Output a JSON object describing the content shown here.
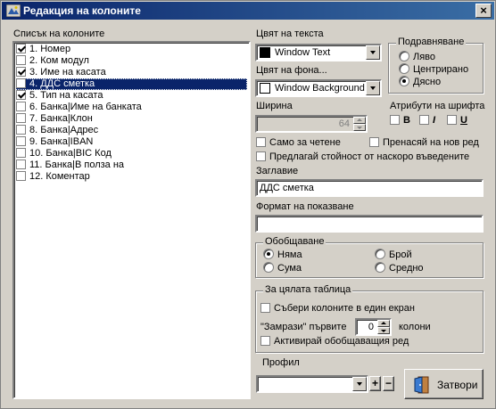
{
  "window": {
    "title": "Редакция на колоните",
    "close_glyph": "×"
  },
  "columns": {
    "label": "Списък на колоните",
    "items": [
      {
        "label": "1. Номер",
        "checked": true,
        "selected": false
      },
      {
        "label": "2. Ком модул",
        "checked": false,
        "selected": false
      },
      {
        "label": "3. Име на касата",
        "checked": true,
        "selected": false
      },
      {
        "label": "4. ДДС сметка",
        "checked": false,
        "selected": true
      },
      {
        "label": "5. Тип на касата",
        "checked": true,
        "selected": false
      },
      {
        "label": "6. Банка|Име на банката",
        "checked": false,
        "selected": false
      },
      {
        "label": "7. Банка|Клон",
        "checked": false,
        "selected": false
      },
      {
        "label": "8. Банка|Адрес",
        "checked": false,
        "selected": false
      },
      {
        "label": "9. Банка|IBAN",
        "checked": false,
        "selected": false
      },
      {
        "label": "10. Банка|BIC Код",
        "checked": false,
        "selected": false
      },
      {
        "label": "11. Банка|В полза на",
        "checked": false,
        "selected": false
      },
      {
        "label": "12. Коментар",
        "checked": false,
        "selected": false
      }
    ]
  },
  "text_color": {
    "label": "Цвят на текста",
    "value": "Window Text",
    "swatch": "#000000"
  },
  "back_color": {
    "label": "Цвят на фона...",
    "value": "Window Background",
    "swatch": "#ffffff"
  },
  "alignment": {
    "label": "Подравняване",
    "options": [
      "Ляво",
      "Центрирано",
      "Дясно"
    ],
    "selected": "Дясно"
  },
  "width": {
    "label": "Ширина",
    "value": "64"
  },
  "font_attrs": {
    "label": "Атрибути на шрифта",
    "bold": "B",
    "italic": "I",
    "underline": "U"
  },
  "read_only": {
    "label": "Само за четене",
    "checked": false
  },
  "wrap": {
    "label": "Пренасяй на нов ред",
    "checked": false
  },
  "suggest": {
    "label": "Предлагай стойност от наскоро въведените",
    "checked": false
  },
  "caption": {
    "label": "Заглавие",
    "value": "ДДС сметка"
  },
  "format": {
    "label": "Формат на показване",
    "value": ""
  },
  "aggregate": {
    "label": "Обобщаване",
    "options": [
      "Няма",
      "Брой",
      "Сума",
      "Средно"
    ],
    "selected": "Няма"
  },
  "whole_table": {
    "label": "За цялата таблица",
    "fit_screen": {
      "label": "Събери колоните в един екран",
      "checked": false
    },
    "freeze_prefix": "\"Замрази\" първите",
    "freeze_value": "0",
    "freeze_suffix": "колони",
    "activate_summary": {
      "label": "Активирай обобщаващия ред",
      "checked": false
    }
  },
  "profile": {
    "label": "Профил",
    "value": "",
    "add": "+",
    "remove": "−"
  },
  "close_button": {
    "label": "Затвори"
  }
}
